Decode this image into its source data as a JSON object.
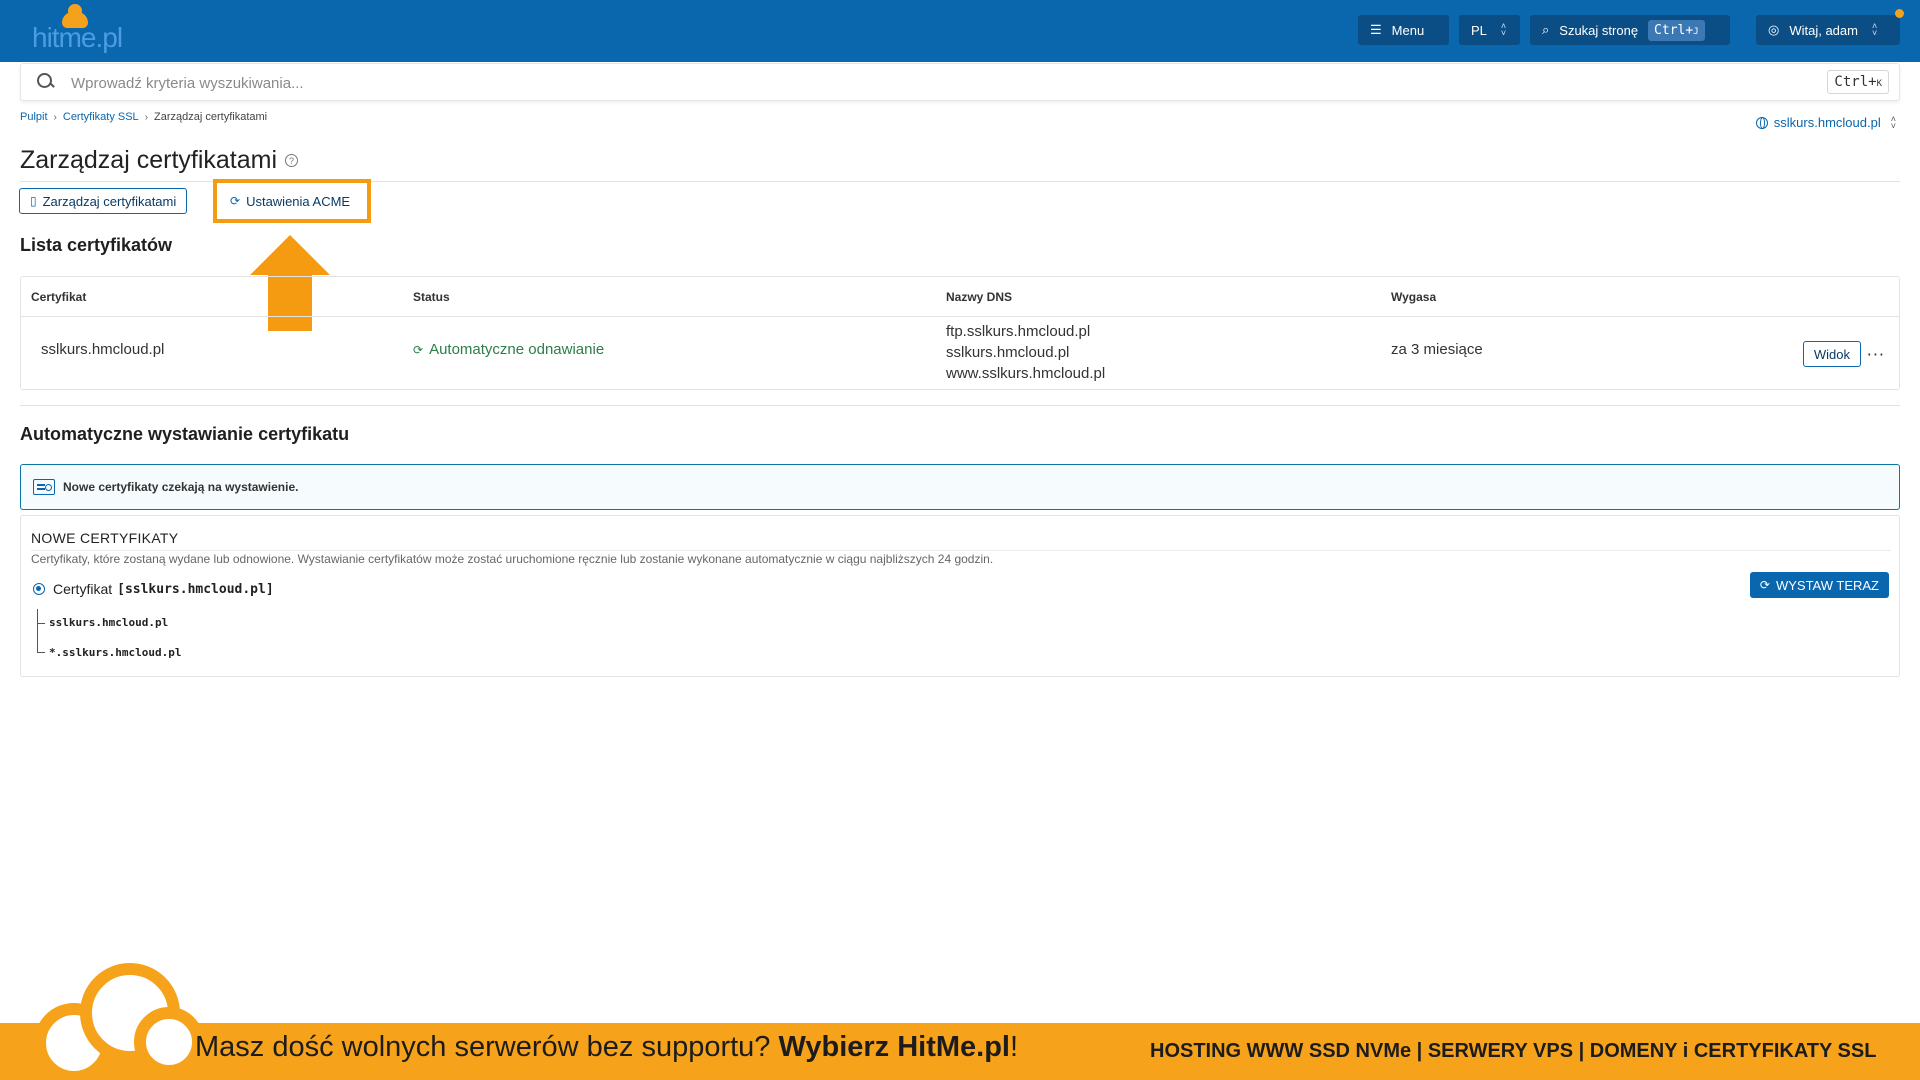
{
  "header": {
    "logo_text": "hitme.pl",
    "menu_label": "Menu",
    "lang_label": "PL",
    "search_label": "Szukaj stronę",
    "search_kbd": "Ctrl+",
    "search_kbd_key": "J",
    "user_label": "Witaj, adam"
  },
  "search": {
    "placeholder": "Wprowadź kryteria wyszukiwania...",
    "kbd": "Ctrl+",
    "kbd_key": "K"
  },
  "breadcrumb": {
    "items": [
      "Pulpit",
      "Certyfikaty SSL"
    ],
    "current": "Zarządzaj certyfikatami"
  },
  "domain_select": "sslkurs.hmcloud.pl",
  "page_title": "Zarządzaj certyfikatami",
  "tabs": [
    {
      "label": "Zarządzaj certyfikatami"
    },
    {
      "label": "Ustawienia ACME"
    }
  ],
  "cert_list": {
    "title": "Lista certyfikatów",
    "columns": [
      "Certyfikat",
      "Status",
      "Nazwy DNS",
      "Wygasa"
    ],
    "rows": [
      {
        "certificate": "sslkurs.hmcloud.pl",
        "status": "Automatyczne odnawianie",
        "dns": [
          "ftp.sslkurs.hmcloud.pl",
          "sslkurs.hmcloud.pl",
          "www.sslkurs.hmcloud.pl"
        ],
        "expires": "za 3 miesiące",
        "view_label": "Widok",
        "more_label": "···"
      }
    ]
  },
  "auto_issue": {
    "title": "Automatyczne wystawianie certyfikatu",
    "info": "Nowe certyfikaty czekają na wystawienie.",
    "new_heading": "NOWE CERTYFIKATY",
    "description": "Certyfikaty, które zostaną wydane lub odnowione. Wystawianie certyfikatów może zostać uruchomione ręcznie lub zostanie wykonane automatycznie w ciągu najbliższych 24 godzin.",
    "cert_label": "Certyfikat",
    "cert_name": "[sslkurs.hmcloud.pl]",
    "domains": [
      "sslkurs.hmcloud.pl",
      "*.sslkurs.hmcloud.pl"
    ],
    "issue_button": "WYSTAW TERAZ"
  },
  "banner": {
    "main_text": "Masz dość wolnych serwerów bez supportu?",
    "main_bold": "Wybierz HitMe.pl",
    "main_end": "!",
    "right_text": "HOSTING WWW SSD NVMe | SERWERY VPS | DOMENY i CERTYFIKATY SSL"
  },
  "colors": {
    "header_bg": "#0a66ad",
    "accent": "#0a66ad",
    "highlight": "#f39c12",
    "banner_bg": "#f7a21b",
    "status_green": "#2c7d4a"
  }
}
